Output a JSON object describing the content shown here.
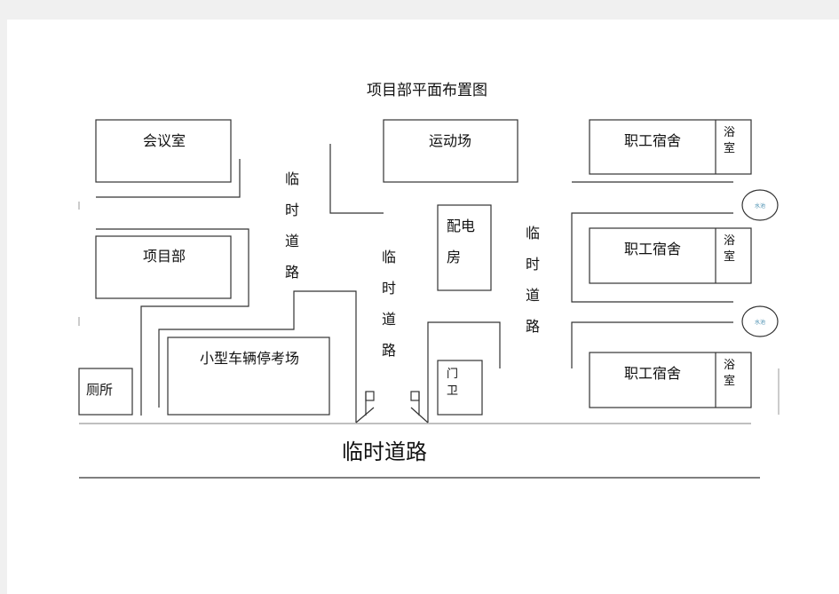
{
  "title": "项目部平面布置图",
  "rooms": {
    "meeting": "会议室",
    "project_office": "项目部",
    "parking": "小型车辆停考场",
    "toilet": "厕所",
    "sports": "运动场",
    "power_room": [
      "配电",
      "房"
    ],
    "guard": [
      "门",
      "卫"
    ],
    "dorm": "职工宿舍",
    "bath": [
      "浴",
      "室"
    ],
    "pool": "水池"
  },
  "road_vertical": [
    "临",
    "时",
    "道",
    "路"
  ],
  "road_main": "临时道路",
  "colors": {
    "line": "#222222",
    "pool_text": "#4a8fb0"
  }
}
